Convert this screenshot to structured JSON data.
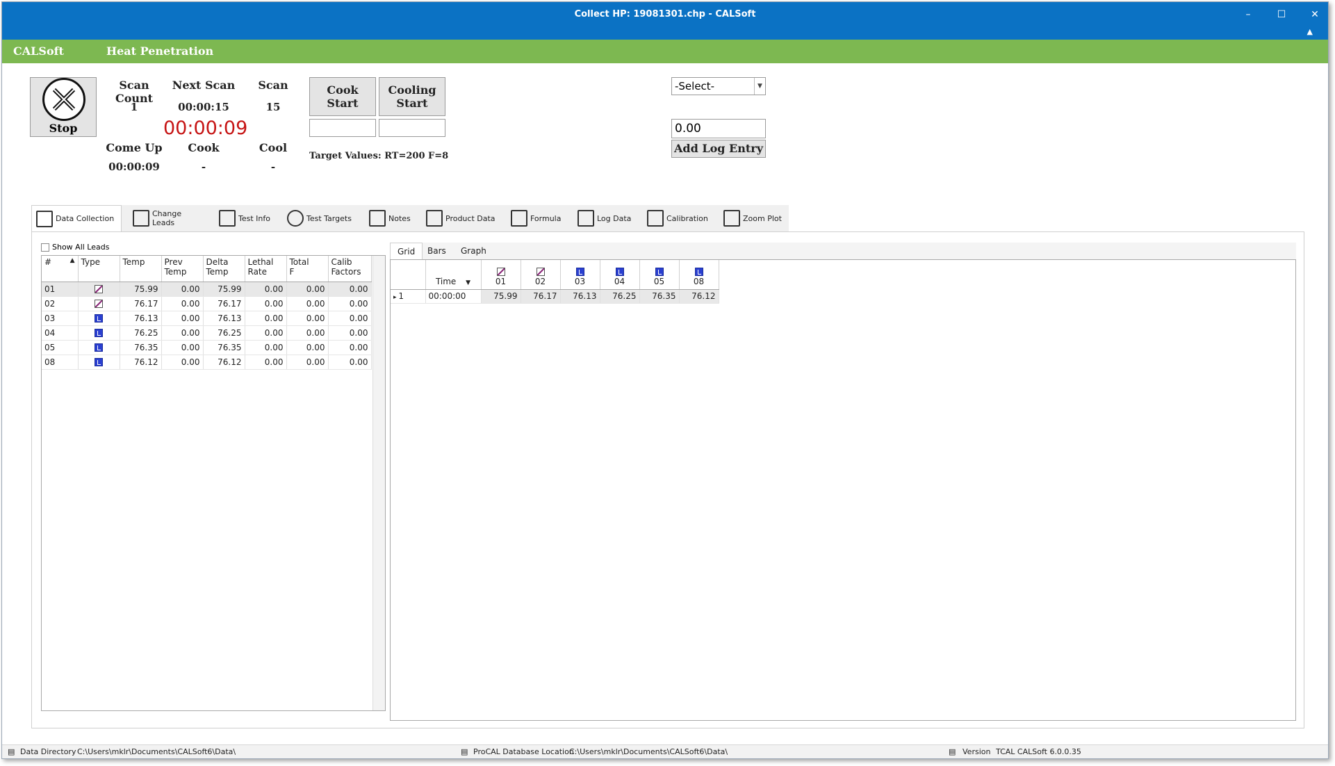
{
  "window": {
    "title": "Collect HP: 19081301.chp - CALSoft",
    "min": "–",
    "max": "☐",
    "close": "✕"
  },
  "header": {
    "app": "CALSoft",
    "module": "Heat Penetration"
  },
  "controls": {
    "stop_label": "Stop",
    "scan_count_label": "Scan Count",
    "scan_count": "1",
    "next_scan_label": "Next Scan",
    "next_scan": "00:00:15",
    "scan_label": "Scan",
    "scan": "15",
    "elapsed": "00:00:09",
    "come_up_label": "Come Up",
    "come_up": "00:00:09",
    "cook_label": "Cook",
    "cook": "-",
    "cool_label": "Cool",
    "cool": "-",
    "cook_start_1": "Cook",
    "cook_start_2": "Start",
    "cooling_start_1": "Cooling",
    "cooling_start_2": "Start",
    "target_values": "Target Values: RT=200  F=8",
    "select_value": "-Select-",
    "log_value": "0.00",
    "add_log_label": "Add Log Entry"
  },
  "tabs": [
    "Data Collection",
    "Change Leads",
    "Test Info",
    "Test Targets",
    "Notes",
    "Product Data",
    "Formula",
    "Log Data",
    "Calibration",
    "Zoom Plot"
  ],
  "show_all_leads": "Show All Leads",
  "lead_table": {
    "headers": [
      [
        "#"
      ],
      [
        "Type"
      ],
      [
        "Temp"
      ],
      [
        "Prev",
        "Temp"
      ],
      [
        "Delta",
        "Temp"
      ],
      [
        "Lethal",
        "Rate"
      ],
      [
        "Total",
        "F"
      ],
      [
        "Calib",
        "Factors"
      ]
    ],
    "rows": [
      {
        "id": "01",
        "type": "A",
        "temp": "75.99",
        "prev": "0.00",
        "delta": "75.99",
        "lethal": "0.00",
        "total": "0.00",
        "calib": "0.00"
      },
      {
        "id": "02",
        "type": "A",
        "temp": "76.17",
        "prev": "0.00",
        "delta": "76.17",
        "lethal": "0.00",
        "total": "0.00",
        "calib": "0.00"
      },
      {
        "id": "03",
        "type": "B",
        "temp": "76.13",
        "prev": "0.00",
        "delta": "76.13",
        "lethal": "0.00",
        "total": "0.00",
        "calib": "0.00"
      },
      {
        "id": "04",
        "type": "B",
        "temp": "76.25",
        "prev": "0.00",
        "delta": "76.25",
        "lethal": "0.00",
        "total": "0.00",
        "calib": "0.00"
      },
      {
        "id": "05",
        "type": "B",
        "temp": "76.35",
        "prev": "0.00",
        "delta": "76.35",
        "lethal": "0.00",
        "total": "0.00",
        "calib": "0.00"
      },
      {
        "id": "08",
        "type": "B",
        "temp": "76.12",
        "prev": "0.00",
        "delta": "76.12",
        "lethal": "0.00",
        "total": "0.00",
        "calib": "0.00"
      }
    ]
  },
  "subtabs": [
    "Grid",
    "Bars",
    "Graph"
  ],
  "scan_grid": {
    "time_header": "Time",
    "columns": [
      {
        "id": "01",
        "type": "A"
      },
      {
        "id": "02",
        "type": "A"
      },
      {
        "id": "03",
        "type": "B"
      },
      {
        "id": "04",
        "type": "B"
      },
      {
        "id": "05",
        "type": "B"
      },
      {
        "id": "08",
        "type": "B"
      }
    ],
    "rows": [
      {
        "n": "1",
        "time": "00:00:00",
        "values": [
          "75.99",
          "76.17",
          "76.13",
          "76.25",
          "76.35",
          "76.12"
        ]
      }
    ]
  },
  "status": {
    "data_dir_label": "Data Directory",
    "data_dir": "C:\\Users\\mklr\\Documents\\CALSoft6\\Data\\",
    "db_label": "ProCAL Database Location",
    "db": "C:\\Users\\mklr\\Documents\\CALSoft6\\Data\\",
    "version_label": "Version",
    "version": "TCAL CALSoft 6.0.0.35"
  }
}
